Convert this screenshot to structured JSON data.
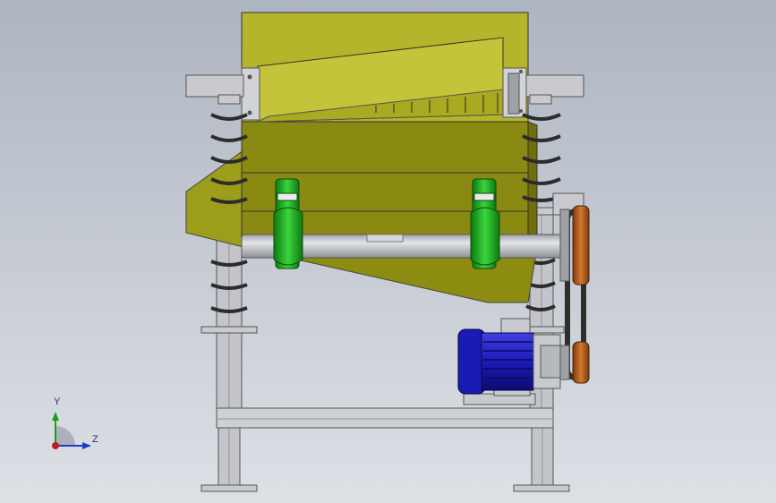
{
  "triad": {
    "y_label": "Y",
    "z_label": "Z"
  },
  "colors": {
    "hopper": "#b5b52b",
    "box": "#8c8c10",
    "shaft": "#bfc1c6",
    "bearing": "#29b82c",
    "motor": "#1f1fc4",
    "belt": "#2e2e2e",
    "pulley": "#c0661f",
    "frame": "#c8cacf"
  }
}
